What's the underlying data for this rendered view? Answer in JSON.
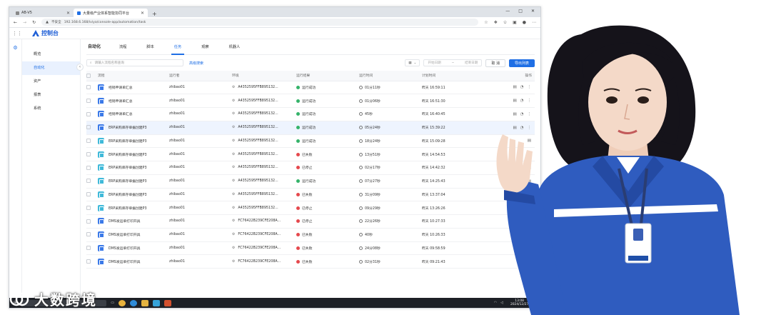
{
  "browser": {
    "tabs": [
      {
        "label": "AB-V5"
      },
      {
        "label": "大量级产业体系智能协同平台"
      }
    ],
    "insecure_label": "不安全",
    "url": "192.168.6.168/iviya/console-app/automation/task",
    "window_controls": [
      "—",
      "□",
      "✕"
    ]
  },
  "app": {
    "title": "控制台",
    "sidebar": [
      "概览",
      "自动化",
      "资产",
      "报表",
      "系统"
    ],
    "subtabs": [
      "自动化",
      "流程",
      "脚本",
      "任务",
      "观察",
      "机器人"
    ],
    "active_subtab": 3,
    "search_placeholder": "请输入流程名称查询",
    "advanced_search": "高级搜索",
    "date_start": "开始日期",
    "date_end": "结束日期",
    "btn_cancel": "取 消",
    "btn_export": "导出列表",
    "columns": [
      "流程",
      "运行者",
      "环境",
      "运行结果",
      "运行时间",
      "计划时间",
      "操作"
    ],
    "rows": [
      {
        "flow": "经销申请单汇总",
        "icon": "blue",
        "user": "zhibao01",
        "env": "A4352595FFB895132...",
        "status": "运行成功",
        "status_color": "#35b36a",
        "duration": "01分11秒",
        "time": "昨天 16:59:11"
      },
      {
        "flow": "经销申请单汇总",
        "icon": "blue",
        "user": "zhibao01",
        "env": "A4352595FFB895132...",
        "status": "运行成功",
        "status_color": "#35b36a",
        "duration": "01分06秒",
        "time": "昨天 16:51:30"
      },
      {
        "flow": "经销申请单汇总",
        "icon": "blue",
        "user": "zhibao01",
        "env": "A4352595FFB895132...",
        "status": "运行成功",
        "status_color": "#35b36a",
        "duration": "45秒",
        "time": "昨天 16:40:45"
      },
      {
        "flow": "ERP采购库存单据创建P3",
        "icon": "blue",
        "user": "zhibao01",
        "env": "A4352595FFB895132...",
        "status": "运行成功",
        "status_color": "#35b36a",
        "duration": "05分24秒",
        "time": "昨天 15:39:22"
      },
      {
        "flow": "ERP采购库存单据创建P3",
        "icon": "cyan",
        "user": "zhibao01",
        "env": "A4352595FFB895132...",
        "status": "运行成功",
        "status_color": "#35b36a",
        "duration": "18分24秒",
        "time": "昨天 15:09:28"
      },
      {
        "flow": "ERP采购库存单据创建P3",
        "icon": "cyan",
        "user": "zhibao01",
        "env": "A4352595FFB895132...",
        "status": "已失败",
        "status_color": "#e5484d",
        "duration": "13分51秒",
        "time": "昨天 14:54:53"
      },
      {
        "flow": "ERP采购库存单据创建P3",
        "icon": "cyan",
        "user": "zhibao01",
        "env": "A4352595FFB895132...",
        "status": "已停止",
        "status_color": "#e5484d",
        "duration": "02分17秒",
        "time": "昨天 14:42:32"
      },
      {
        "flow": "ERP采购库存单据创建P3",
        "icon": "cyan",
        "user": "zhibao01",
        "env": "A4352595FFB895132...",
        "status": "运行成功",
        "status_color": "#35b36a",
        "duration": "07分27秒",
        "time": "昨天 14:25:43"
      },
      {
        "flow": "ERP采购库存单据创建P3",
        "icon": "cyan",
        "user": "zhibao01",
        "env": "A4352595FFB895132...",
        "status": "已失败",
        "status_color": "#e5484d",
        "duration": "31分09秒",
        "time": "昨天 13:37:04"
      },
      {
        "flow": "ERP采购库存单据创建P3",
        "icon": "cyan",
        "user": "zhibao01",
        "env": "A4352595FFB895132...",
        "status": "已停止",
        "status_color": "#e5484d",
        "duration": "09分29秒",
        "time": "昨天 13:26:26"
      },
      {
        "flow": "DMS发运单打印开具",
        "icon": "blue",
        "user": "zhibao01",
        "env": "FC76422B239CFE208A...",
        "status": "已停止",
        "status_color": "#e5484d",
        "duration": "22分26秒",
        "time": "昨天 10:27:33"
      },
      {
        "flow": "DMS发运单打印开具",
        "icon": "blue",
        "user": "zhibao01",
        "env": "FC76422B239CFE208A...",
        "status": "已失败",
        "status_color": "#e5484d",
        "duration": "40秒",
        "time": "昨天 10:26:33"
      },
      {
        "flow": "DMS发运单打印开具",
        "icon": "blue",
        "user": "zhibao01",
        "env": "FC76422B239CFE208A...",
        "status": "已失败",
        "status_color": "#e5484d",
        "duration": "24分08秒",
        "time": "昨天 09:58:59"
      },
      {
        "flow": "DMS发运单打印开具",
        "icon": "blue",
        "user": "zhibao01",
        "env": "FC76422B239CFE208A...",
        "status": "已失败",
        "status_color": "#e5484d",
        "duration": "02分31秒",
        "time": "昨天 09:21:43"
      }
    ]
  },
  "taskbar": {
    "time": "13:08",
    "date": "2024/12/27"
  },
  "watermark": "大数跨境",
  "accent": "#1f6fe5"
}
